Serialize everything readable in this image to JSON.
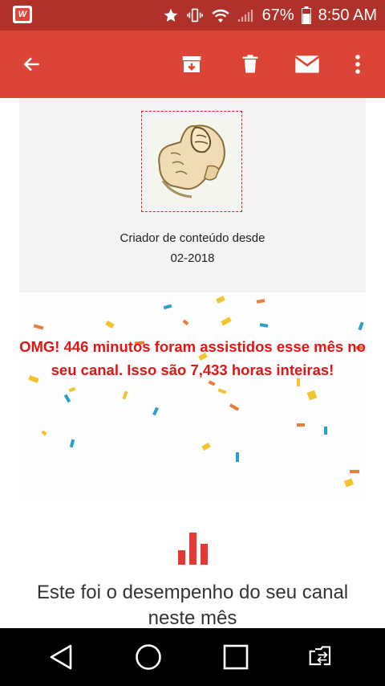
{
  "status_bar": {
    "app_icon": "W",
    "battery": "67%",
    "time": "8:50 AM",
    "icons": [
      "star-icon",
      "vibrate-icon",
      "wifi-icon",
      "signal-icon",
      "battery-icon"
    ]
  },
  "app_bar": {
    "back": "arrow-back-icon",
    "actions": [
      "archive-icon",
      "delete-icon",
      "mail-icon",
      "more-vert-icon"
    ]
  },
  "card": {
    "creator_label": "Criador de conteúdo desde",
    "creator_date": "02-2018"
  },
  "celebration": {
    "message": "OMG! 446 minutos foram assistidos esse mês no seu canal. Isso são 7,433 horas inteiras!"
  },
  "performance": {
    "icon": "bar-chart-icon",
    "title": "Este foi o desempenho do seu canal neste mês"
  },
  "nav_bar": {
    "buttons": [
      "back-triangle-icon",
      "home-circle-icon",
      "recents-square-icon",
      "switch-camera-icon"
    ]
  },
  "colors": {
    "status_bar": "#b0302a",
    "app_bar": "#db4437",
    "accent_red": "#e01616",
    "card_bg": "#f3f3f3"
  }
}
